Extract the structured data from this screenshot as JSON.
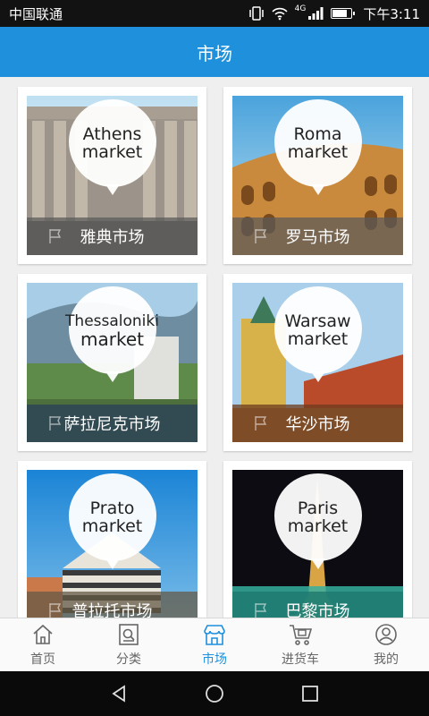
{
  "status_bar": {
    "carrier": "中国联通",
    "network": "4G",
    "time": "下午3:11"
  },
  "header": {
    "title": "市场"
  },
  "markets": [
    {
      "badge_line1": "Athens",
      "badge_line2": "market",
      "label": "雅典市场"
    },
    {
      "badge_line1": "Roma",
      "badge_line2": "market",
      "label": "罗马市场"
    },
    {
      "badge_line1": "Thessaloniki",
      "badge_line2": "market",
      "label": "萨拉尼克市场"
    },
    {
      "badge_line1": "Warsaw",
      "badge_line2": "market",
      "label": "华沙市场"
    },
    {
      "badge_line1": "Prato",
      "badge_line2": "market",
      "label": "普拉托市场"
    },
    {
      "badge_line1": "Paris",
      "badge_line2": "market",
      "label": "巴黎市场"
    }
  ],
  "bottom_nav": {
    "items": [
      {
        "label": "首页",
        "icon": "home-icon"
      },
      {
        "label": "分类",
        "icon": "category-icon"
      },
      {
        "label": "市场",
        "icon": "store-icon",
        "active": true
      },
      {
        "label": "进货车",
        "icon": "cart-icon"
      },
      {
        "label": "我的",
        "icon": "user-icon"
      }
    ]
  },
  "colors": {
    "primary": "#1e90dc",
    "status_bar": "#121212"
  }
}
